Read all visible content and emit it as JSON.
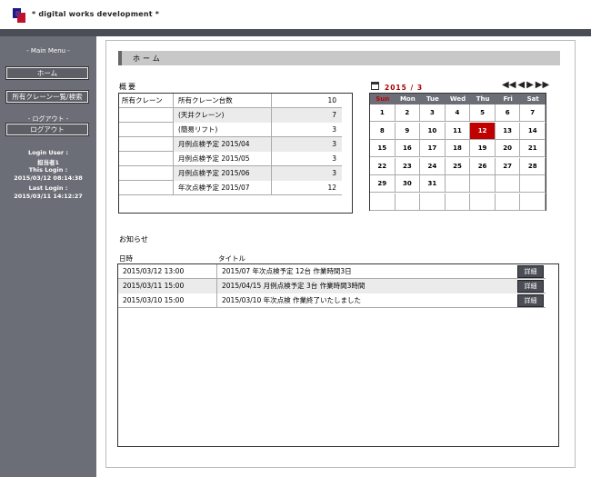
{
  "brand": "* digital works development *",
  "sidebar": {
    "main_menu": "- Main Menu -",
    "home_button": "ホーム",
    "cranes_button": "所有クレーン一覧/検索",
    "logout_head": "- ログアウト -",
    "logout_button": "ログアウト",
    "login_user_label": "Login User :",
    "login_user": "担当者1",
    "this_login_label": "This Login :",
    "this_login": "2015/03/12 08:14:38",
    "last_login_label": "Last Login :",
    "last_login": "2015/03/11 14:12:27"
  },
  "main": {
    "title": "ホーム",
    "summary_label": "概要",
    "summary_rows": [
      {
        "c1": "所有クレーン",
        "c2": "所有クレーン台数",
        "c3": "10"
      },
      {
        "c1": "",
        "c2": "(天井クレーン)",
        "c3": "7"
      },
      {
        "c1": "",
        "c2": "(簡易リフト)",
        "c3": "3"
      },
      {
        "c1": "",
        "c2": "月例点検予定 2015/04",
        "c3": "3"
      },
      {
        "c1": "",
        "c2": "月例点検予定 2015/05",
        "c3": "3"
      },
      {
        "c1": "",
        "c2": "月例点検予定 2015/06",
        "c3": "3"
      },
      {
        "c1": "",
        "c2": "年次点検予定 2015/07",
        "c3": "12"
      }
    ],
    "news_label": "お知らせ",
    "news_col_date": "日時",
    "news_col_title": "タイトル",
    "news_detail": "詳細",
    "news_rows": [
      {
        "date": "2015/03/12 13:00",
        "title": "2015/07 年次点検予定 12台 作業時間3日"
      },
      {
        "date": "2015/03/11 15:00",
        "title": "2015/04/15 月例点検予定 3台 作業時間3時間"
      },
      {
        "date": "2015/03/10 15:00",
        "title": "2015/03/10 年次点検 作業終了いたしました"
      }
    ]
  },
  "calendar": {
    "month": "2015 / 3",
    "nav": [
      "◀◀",
      "◀",
      "▶",
      "▶▶"
    ],
    "days": [
      "Sun",
      "Mon",
      "Tue",
      "Wed",
      "Thu",
      "Fri",
      "Sat"
    ],
    "weeks": [
      [
        "1",
        "2",
        "3",
        "4",
        "5",
        "6",
        "7"
      ],
      [
        "8",
        "9",
        "10",
        "11",
        "12",
        "13",
        "14"
      ],
      [
        "15",
        "16",
        "17",
        "18",
        "19",
        "20",
        "21"
      ],
      [
        "22",
        "23",
        "24",
        "25",
        "26",
        "27",
        "28"
      ],
      [
        "29",
        "30",
        "31",
        "",
        "",
        "",
        ""
      ],
      [
        "",
        "",
        "",
        "",
        "",
        "",
        ""
      ]
    ],
    "today": "12",
    "colors": {
      "today": "#c00000",
      "sunday": "#c00000",
      "header_bg": "#6b6e77"
    }
  }
}
